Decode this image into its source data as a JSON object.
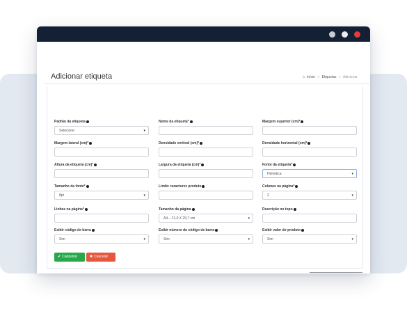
{
  "window": {
    "dots": [
      "#c9ccd3",
      "#e9ebef",
      "#e23b3b"
    ]
  },
  "page": {
    "title": "Adicionar etiqueta",
    "breadcrumb": {
      "home": "Início",
      "section": "Etiquetas",
      "current": "Adicionar"
    }
  },
  "form": {
    "fields": [
      {
        "label": "Padrão da etiqueta",
        "type": "select",
        "value": "Selecione"
      },
      {
        "label": "Nome da etiqueta*",
        "type": "input",
        "value": ""
      },
      {
        "label": "Margem superior (cm)*",
        "type": "input",
        "value": ""
      },
      {
        "label": "Margem lateral (cm)*",
        "type": "input",
        "value": ""
      },
      {
        "label": "Densidade vertical (cm)*",
        "type": "input",
        "value": ""
      },
      {
        "label": "Densidade horizontal (cm)*",
        "type": "input",
        "value": ""
      },
      {
        "label": "Altura da etiqueta (cm)*",
        "type": "input",
        "value": ""
      },
      {
        "label": "Largura da etiqueta (cm)*",
        "type": "input",
        "value": ""
      },
      {
        "label": "Fonte da etiqueta*",
        "type": "select",
        "value": "Helvetica"
      },
      {
        "label": "Tamanho da fonte*",
        "type": "select",
        "value": "8pt"
      },
      {
        "label": "Limite caracteres produto",
        "type": "input",
        "value": ""
      },
      {
        "label": "Colunas na página*",
        "type": "select",
        "value": "2"
      },
      {
        "label": "Linhas na página*",
        "type": "input",
        "value": ""
      },
      {
        "label": "Tamanho da página",
        "type": "select",
        "value": "A4 – 21,0 X 29,7 cm"
      },
      {
        "label": "Descrição no topo",
        "type": "input",
        "value": ""
      },
      {
        "label": "Exibir código de barra",
        "type": "select",
        "value": "Sim"
      },
      {
        "label": "Exibir número do código de barra",
        "type": "select",
        "value": "Sim"
      },
      {
        "label": "Exibir valor do produto",
        "type": "select",
        "value": "Sim"
      }
    ],
    "buttons": {
      "save": "Cadastrar",
      "cancel": "Cancelar"
    }
  }
}
